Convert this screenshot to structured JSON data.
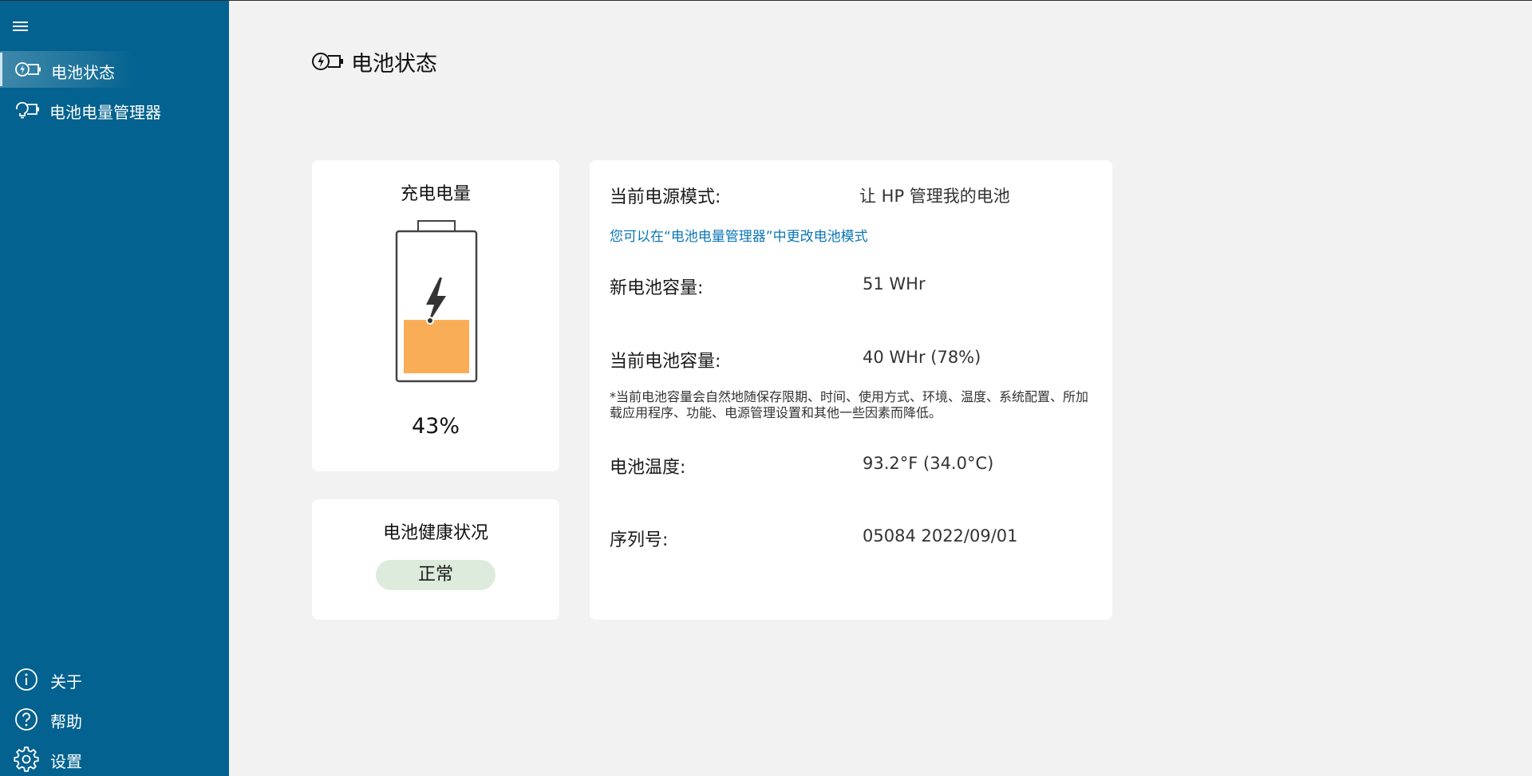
{
  "sidebar": {
    "menu_icon": "hamburger-menu-icon",
    "items": [
      {
        "label": "电池状态",
        "icon": "battery-status-icon",
        "active": true
      },
      {
        "label": "电池电量管理器",
        "icon": "battery-manager-icon",
        "active": false
      }
    ],
    "footer": [
      {
        "label": "关于",
        "icon": "info-icon"
      },
      {
        "label": "帮助",
        "icon": "help-icon"
      },
      {
        "label": "设置",
        "icon": "gear-icon"
      }
    ]
  },
  "page": {
    "title": "电池状态",
    "title_icon": "battery-status-icon"
  },
  "charge": {
    "title": "充电电量",
    "value": "43%",
    "level": 0.43,
    "fill_color": "#f9ad56",
    "icon": "lightning-bolt-icon"
  },
  "health": {
    "title": "电池健康状况",
    "status": "正常",
    "badge_color": "#dcebdc"
  },
  "info": {
    "power_mode_label": "当前电源模式:",
    "power_mode_value": "让 HP 管理我的电池",
    "change_link": "您可以在“电池电量管理器”中更改电池模式",
    "design_capacity_label": "新电池容量:",
    "design_capacity_value": "51 WHr",
    "current_capacity_label": "当前电池容量:",
    "current_capacity_value": "40 WHr (78%)",
    "capacity_note": "*当前电池容量会自然地随保存限期、时间、使用方式、环境、温度、系统配置、所加载应用程序、功能、电源管理设置和其他一些因素而降低。",
    "temperature_label": "电池温度:",
    "temperature_value": "93.2°F (34.0°C)",
    "serial_label": "序列号:",
    "serial_value": "05084 2022/09/01"
  },
  "colors": {
    "sidebar_bg": "#03628f",
    "page_bg": "#f2f2f2",
    "link": "#0b76b5"
  }
}
